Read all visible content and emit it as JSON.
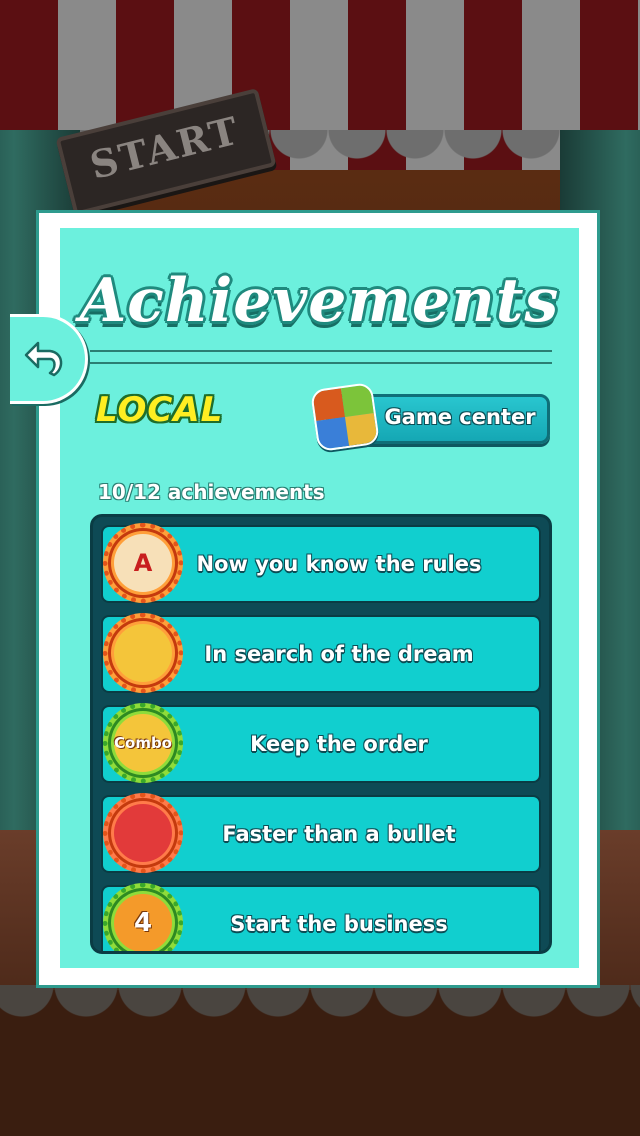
{
  "background": {
    "start_sign": "START"
  },
  "dialog": {
    "title": "Achievements",
    "tab_label": "LOCAL",
    "game_center_label": "Game center",
    "achievements_count": "10/12 achievements"
  },
  "back_button": {
    "icon": "back-arrow-icon"
  },
  "achievements": [
    {
      "label": "Now you know the rules",
      "icon": "scroll-a-badge-icon",
      "badge_text": "A",
      "badge_color": "#ff9f3a"
    },
    {
      "label": "In search of the dream",
      "icon": "magic-lamp-badge-icon",
      "badge_text": "",
      "badge_color": "#ff9f3a"
    },
    {
      "label": "Keep the order",
      "icon": "combo-badge-icon",
      "badge_text": "Combo",
      "badge_color": "#8fdc3a"
    },
    {
      "label": "Faster than a bullet",
      "icon": "gift-cake-badge-icon",
      "badge_text": "",
      "badge_color": "#ff7b4a"
    },
    {
      "label": "Start the business",
      "icon": "stall-4-badge-icon",
      "badge_text": "4",
      "badge_color": "#8fdc3a"
    }
  ],
  "colors": {
    "panel": "#6cf0dd",
    "row": "#11cfcf",
    "list_frame": "#0e4a55",
    "local_text": "#ffee22"
  }
}
